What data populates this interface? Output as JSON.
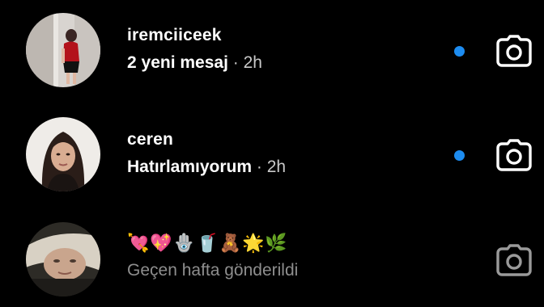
{
  "threads": [
    {
      "username": "iremciiceek",
      "message": "2 yeni mesaj",
      "separator": "·",
      "time": "2h",
      "unread": true,
      "avatar_icon": "profile-photo-woman-red-top"
    },
    {
      "username": "ceren",
      "message": "Hatırlamıyorum",
      "separator": "·",
      "time": "2h",
      "unread": true,
      "avatar_icon": "profile-photo-woman-dark-hair"
    },
    {
      "emoji_text": "💘💖🪬🥤🧸🌟🌿",
      "status": "Geçen hafta gönderildi",
      "unread": false,
      "avatar_icon": "profile-photo-blurred-selfie"
    }
  ],
  "colors": {
    "background": "#000000",
    "unread_dot": "#1d8cf0",
    "muted_text": "#8e8e8e",
    "camera_active": "#ffffff",
    "camera_muted": "#9a9a9a"
  },
  "icons": {
    "camera": "camera-icon",
    "unread": "unread-dot-icon"
  }
}
